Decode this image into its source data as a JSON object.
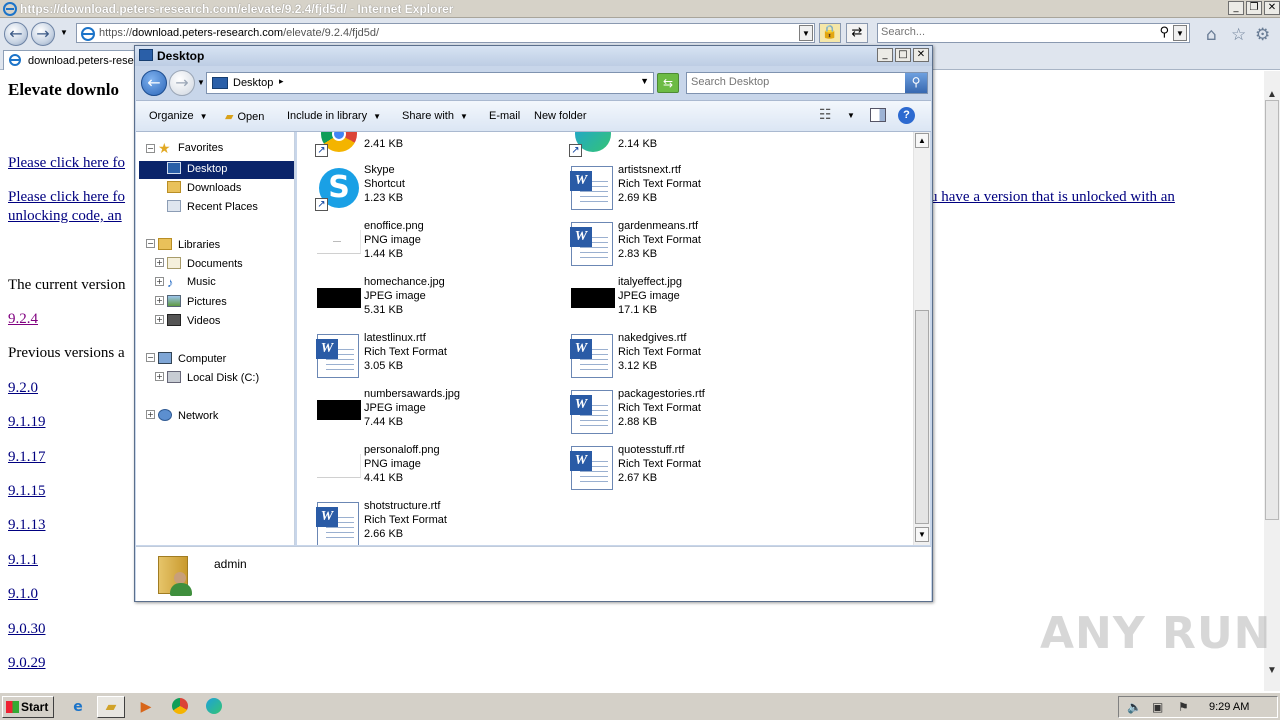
{
  "ie": {
    "title": "https://download.peters-research.com/elevate/9.2.4/fjd5d/ - Internet Explorer",
    "url_prefix": "https://",
    "url_host": "download.peters-research.com",
    "url_path": "/elevate/9.2.4/fjd5d/",
    "search_placeholder": "Search...",
    "tab_label": "download.peters-rese..."
  },
  "page": {
    "heading": "Elevate downlo",
    "link1": "Please click here fo",
    "link2a": "Please click here fo",
    "link2b": "u have a version that is unlocked with an",
    "link2c": "unlocking code, an",
    "current_version_label": "The current version",
    "current_version": "9.2.4",
    "previous_label": "Previous versions a",
    "versions": [
      "9.2.0",
      "9.1.19",
      "9.1.17",
      "9.1.15",
      "9.1.13",
      "9.1.1",
      "9.1.0",
      "9.0.30",
      "9.0.29"
    ]
  },
  "explorer": {
    "title": "Desktop",
    "path": "Desktop",
    "search_placeholder": "Search Desktop",
    "toolbar": {
      "organize": "Organize",
      "open": "Open",
      "include": "Include in library",
      "share": "Share with",
      "email": "E-mail",
      "new_folder": "New folder"
    },
    "nav": {
      "favorites": "Favorites",
      "desktop": "Desktop",
      "downloads": "Downloads",
      "recent": "Recent Places",
      "libraries": "Libraries",
      "documents": "Documents",
      "music": "Music",
      "pictures": "Pictures",
      "videos": "Videos",
      "computer": "Computer",
      "local_disk": "Local Disk (C:)",
      "network": "Network"
    },
    "files": [
      {
        "name": "",
        "kind": "",
        "size": "2.41 KB",
        "icon": "chrome-shortcut-icon"
      },
      {
        "name": "",
        "kind": "",
        "size": "2.14 KB",
        "icon": "edge-shortcut-icon"
      },
      {
        "name": "Skype",
        "kind": "Shortcut",
        "size": "1.23 KB",
        "icon": "skype-icon"
      },
      {
        "name": "artistsnext.rtf",
        "kind": "Rich Text Format",
        "size": "2.69 KB",
        "icon": "word-doc-icon"
      },
      {
        "name": "enoffice.png",
        "kind": "PNG image",
        "size": "1.44 KB",
        "icon": "png-thumb-icon"
      },
      {
        "name": "gardenmeans.rtf",
        "kind": "Rich Text Format",
        "size": "2.83 KB",
        "icon": "word-doc-icon"
      },
      {
        "name": "homechance.jpg",
        "kind": "JPEG image",
        "size": "5.31 KB",
        "icon": "jpg-thumb-icon"
      },
      {
        "name": "italyeffect.jpg",
        "kind": "JPEG image",
        "size": "17.1 KB",
        "icon": "jpg-thumb-icon"
      },
      {
        "name": "latestlinux.rtf",
        "kind": "Rich Text Format",
        "size": "3.05 KB",
        "icon": "word-doc-icon"
      },
      {
        "name": "nakedgives.rtf",
        "kind": "Rich Text Format",
        "size": "3.12 KB",
        "icon": "word-doc-icon"
      },
      {
        "name": "numbersawards.jpg",
        "kind": "JPEG image",
        "size": "7.44 KB",
        "icon": "jpg-thumb-icon"
      },
      {
        "name": "packagestories.rtf",
        "kind": "Rich Text Format",
        "size": "2.88 KB",
        "icon": "word-doc-icon"
      },
      {
        "name": "personaloff.png",
        "kind": "PNG image",
        "size": "4.41 KB",
        "icon": "png-thumb-icon"
      },
      {
        "name": "quotesstuff.rtf",
        "kind": "Rich Text Format",
        "size": "2.67 KB",
        "icon": "word-doc-icon"
      },
      {
        "name": "shotstructure.rtf",
        "kind": "Rich Text Format",
        "size": "2.66 KB",
        "icon": "word-doc-icon"
      }
    ],
    "details_user": "admin"
  },
  "taskbar": {
    "start": "Start",
    "clock": "9:29 AM"
  },
  "watermark": "ANY RUN"
}
